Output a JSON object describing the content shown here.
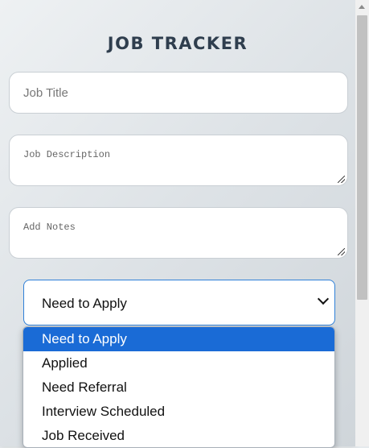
{
  "app": {
    "title": "JOB TRACKER"
  },
  "form": {
    "job_title_placeholder": "Job Title",
    "job_description_placeholder": "Job Description",
    "notes_placeholder": "Add Notes",
    "status": {
      "selected": "Need to Apply",
      "options": [
        "Need to Apply",
        "Applied",
        "Need Referral",
        "Interview Scheduled",
        "Job Received"
      ]
    }
  },
  "icons": {
    "select_arrow": "chevron-down-icon",
    "resize": "resize-grip-icon",
    "scroll": "chevron-up-icon"
  },
  "colors": {
    "accent": "#1a6bd6",
    "title": "#2f3e4e",
    "submit_green": "#4fa85a"
  }
}
